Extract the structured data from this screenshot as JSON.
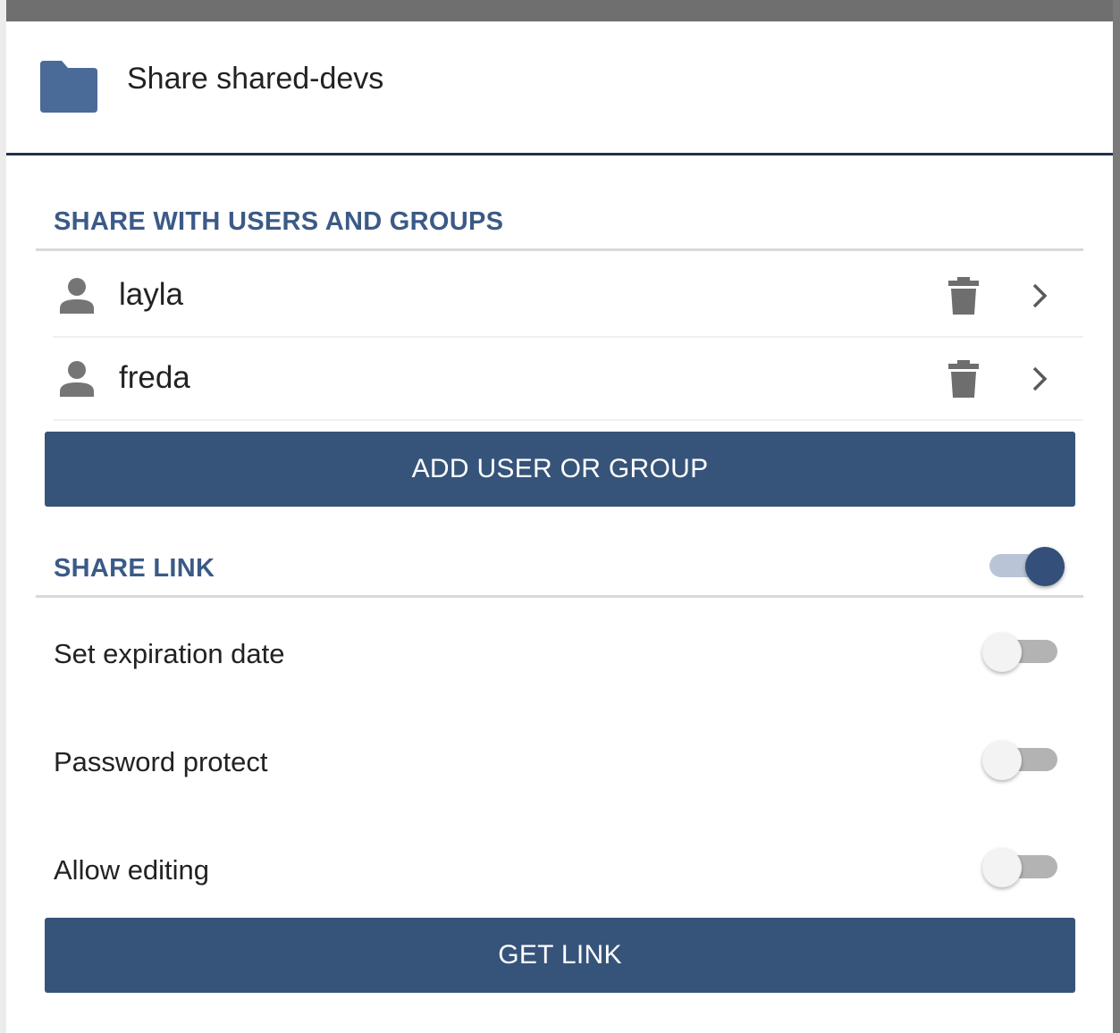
{
  "dialog": {
    "title": "Share shared-devs",
    "folder_color": "#4a6b98"
  },
  "users_section": {
    "title": "SHARE WITH USERS AND GROUPS",
    "users": [
      {
        "name": "layla"
      },
      {
        "name": "freda"
      }
    ],
    "add_button_label": "ADD USER OR GROUP"
  },
  "link_section": {
    "title": "SHARE LINK",
    "enabled": true,
    "options": [
      {
        "label": "Set expiration date",
        "enabled": false
      },
      {
        "label": "Password protect",
        "enabled": false
      },
      {
        "label": "Allow editing",
        "enabled": false
      }
    ],
    "get_link_label": "GET LINK"
  },
  "colors": {
    "accent": "#36547a",
    "section_title": "#3b5a86"
  }
}
